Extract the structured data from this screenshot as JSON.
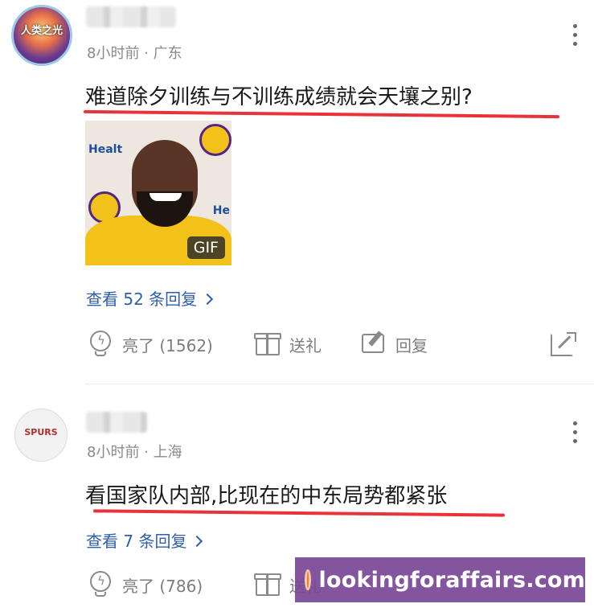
{
  "comments": [
    {
      "avatar_text": "人类之光",
      "meta": "8小时前 · 广东",
      "content": "难道除夕训练与不训练成绩就会天壤之别?",
      "gif_label": "GIF",
      "gif_signs": [
        "Healt",
        "He"
      ],
      "replies": "查看 52 条回复",
      "actions": {
        "like": "亮了 (1562)",
        "gift": "送礼",
        "reply": "回复"
      }
    },
    {
      "avatar_text": "SPURS",
      "meta": "8小时前 · 上海",
      "content": "看国家队内部,比现在的中东局势都紧张",
      "replies": "查看 7 条回复",
      "actions": {
        "like": "亮了 (786)",
        "gift": "送礼"
      }
    }
  ],
  "watermark": "lookingforaffairs.com",
  "colors": {
    "link": "#2f5fa8",
    "underline": "#e8333a",
    "watermark_bg": "#784696"
  }
}
